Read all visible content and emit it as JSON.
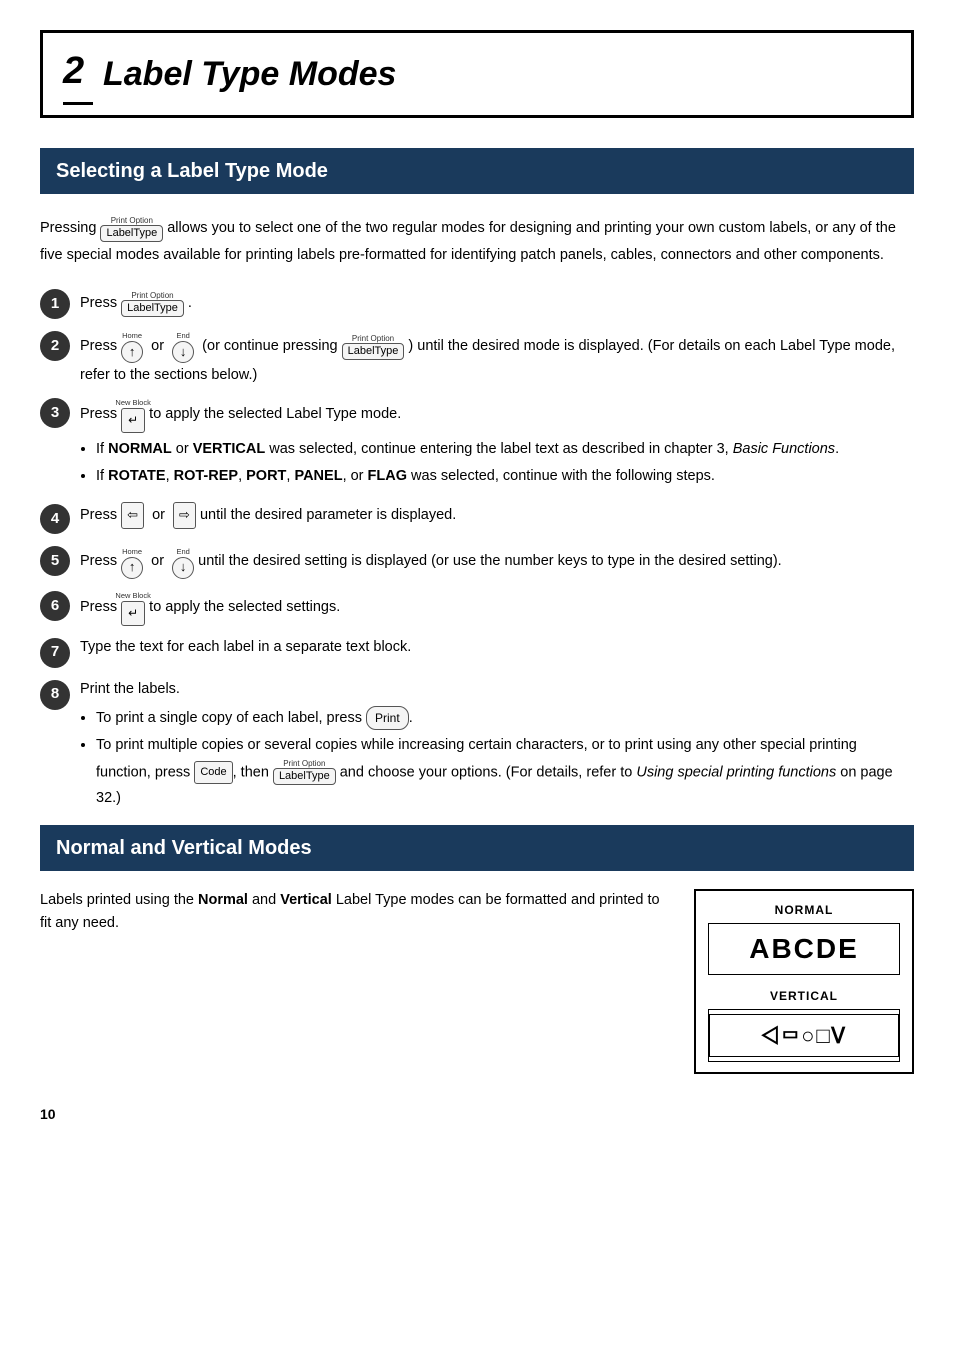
{
  "chapter": {
    "number": "2",
    "title": "Label Type Modes"
  },
  "section1": {
    "header": "Selecting a Label Type Mode",
    "intro": "Pressing  allows you to select one of the two regular modes for designing and printing your own custom labels, or any of the five special modes available for printing labels pre-formatted for identifying patch panels, cables, connectors and other components.",
    "steps": [
      {
        "num": "1",
        "text_before": "Press",
        "key": "LabelType",
        "key_top": "Print Option",
        "text_after": "."
      },
      {
        "num": "2",
        "text_main": "Press  or  (or continue pressing ) until the desired mode is displayed. (For details on each Label Type mode, refer to the sections below.)"
      },
      {
        "num": "3",
        "text_before": "Press",
        "key": "↵",
        "key_top": "New Block",
        "text_after": "to apply the selected Label Type mode.",
        "bullets": [
          "If NORMAL or VERTICAL was selected, continue entering the label text as described in chapter 3, Basic Functions.",
          "If ROTATE, ROT-REP, PORT, PANEL, or FLAG was selected, continue with the following steps."
        ]
      },
      {
        "num": "4",
        "text_main": "Press  or  until the desired parameter is displayed."
      },
      {
        "num": "5",
        "text_main": "Press  or  until the desired setting is displayed (or use the number keys to type in the desired setting)."
      },
      {
        "num": "6",
        "text_before": "Press",
        "key": "↵",
        "key_top": "New Block",
        "text_after": "to apply the selected settings."
      },
      {
        "num": "7",
        "text_main": "Type the text for each label in a separate text block."
      },
      {
        "num": "8",
        "text_main": "Print the labels.",
        "bullets": [
          "To print a single copy of each label, press Print.",
          "To print multiple copies or several copies while increasing certain characters, or to print using any other special printing function, press Code, then LabelType and choose your options. (For details, refer to Using special printing functions on page 32.)"
        ]
      }
    ]
  },
  "section2": {
    "header": "Normal and Vertical Modes",
    "intro": "Labels printed using the Normal and Vertical Label Type modes can be formatted and printed to fit any need.",
    "preview": {
      "normal_label": "NORMAL",
      "normal_text": "ABCDE",
      "vertical_label": "VERTICAL",
      "vertical_text": "◁ω○□ш"
    }
  },
  "page_num": "10"
}
